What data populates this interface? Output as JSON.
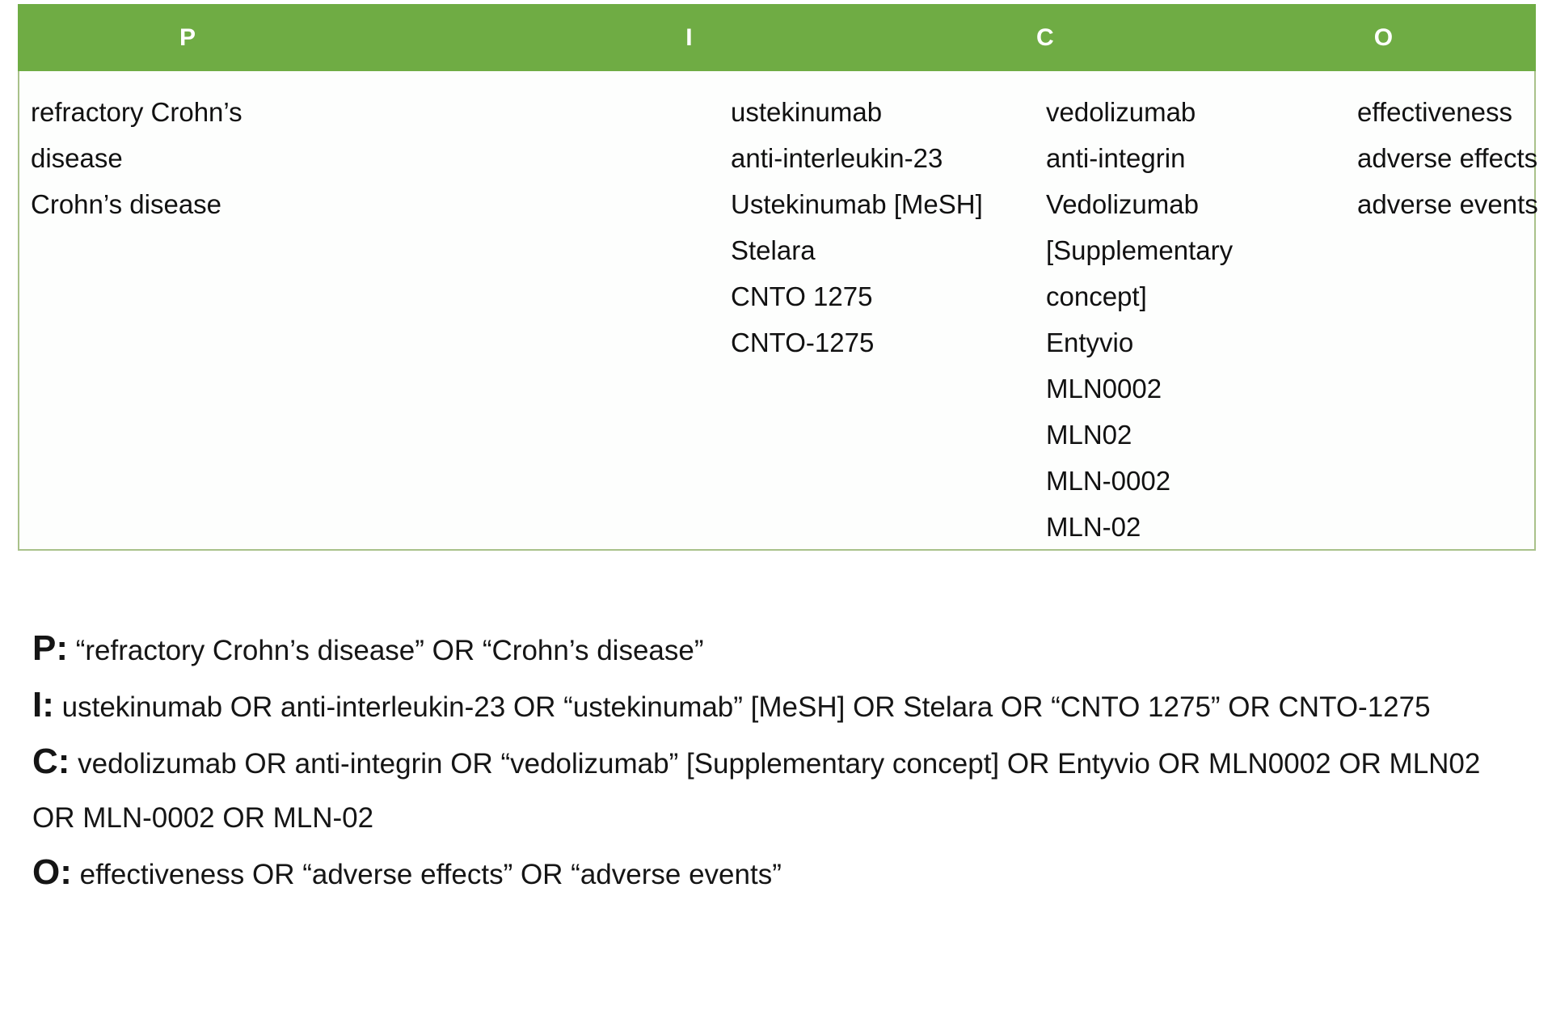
{
  "table": {
    "columns": [
      {
        "key": "P",
        "header": "P",
        "terms": [
          "refractory Crohn’s",
          "disease",
          "Crohn’s disease"
        ]
      },
      {
        "key": "I",
        "header": "I",
        "terms": [
          "ustekinumab",
          "anti-interleukin-23",
          "Ustekinumab [MeSH]",
          "Stelara",
          "CNTO 1275",
          "CNTO-1275"
        ]
      },
      {
        "key": "C",
        "header": "C",
        "terms": [
          "vedolizumab",
          "anti-integrin",
          "Vedolizumab",
          "[Supplementary",
          "concept]",
          "Entyvio",
          "MLN0002",
          "MLN02",
          "MLN-0002",
          "MLN-02"
        ]
      },
      {
        "key": "O",
        "header": "O",
        "terms": [
          "effectiveness",
          "adverse effects",
          "adverse events"
        ]
      }
    ],
    "header_background": "#6fac44",
    "header_text_color": "#ffffff",
    "border_color": "#a9c18a",
    "body_background": "#fdfefd"
  },
  "queries": [
    {
      "prefix": "P:",
      "lines": [
        "“refractory Crohn’s disease” OR “Crohn’s disease”"
      ]
    },
    {
      "prefix": "I:",
      "lines": [
        "ustekinumab OR anti-interleukin-23 OR “ustekinumab” [MeSH] OR Stelara OR",
        "“CNTO 1275” OR CNTO-1275"
      ]
    },
    {
      "prefix": "C:",
      "lines": [
        "vedolizumab OR anti-integrin OR “vedolizumab” [Supplementary concept] OR",
        "Entyvio OR MLN0002 OR MLN02 OR MLN-0002 OR MLN-02"
      ]
    },
    {
      "prefix": "O:",
      "lines": [
        "effectiveness OR “adverse effects” OR “adverse events”"
      ]
    }
  ]
}
